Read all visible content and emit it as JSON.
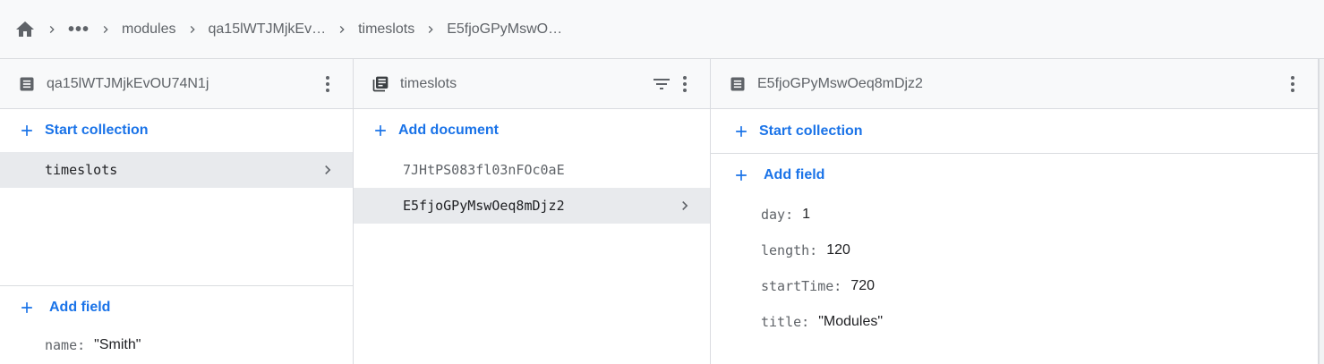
{
  "breadcrumb": {
    "more": "•••",
    "items": [
      "modules",
      "qa15lWTJMjkEv…",
      "timeslots",
      "E5fjoGPyMswO…"
    ]
  },
  "panel1": {
    "title": "qa15lWTJMjkEvOU74N1j",
    "start_collection": "Start collection",
    "collections": [
      "timeslots"
    ],
    "add_field": "Add field",
    "fields": [
      {
        "key": "name:",
        "value": "\"Smith\""
      }
    ]
  },
  "panel2": {
    "title": "timeslots",
    "add_document": "Add document",
    "documents": [
      "7JHtPS083fl03nFOc0aE",
      "E5fjoGPyMswOeq8mDjz2"
    ]
  },
  "panel3": {
    "title": "E5fjoGPyMswOeq8mDjz2",
    "start_collection": "Start collection",
    "add_field": "Add field",
    "fields": [
      {
        "key": "day:",
        "value": "1"
      },
      {
        "key": "length:",
        "value": "120"
      },
      {
        "key": "startTime:",
        "value": "720"
      },
      {
        "key": "title:",
        "value": "\"Modules\""
      }
    ]
  },
  "colors": {
    "accent": "#1a73e8",
    "muted": "#5f6368",
    "selected": "#e8eaed",
    "border": "#dadce0"
  }
}
